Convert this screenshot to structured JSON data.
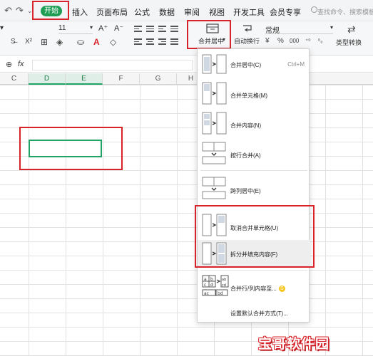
{
  "toolbar": {
    "undo_icon": "undo-icon",
    "redo_icon": "redo-icon",
    "tabs": [
      "开始",
      "插入",
      "页面布局",
      "公式",
      "数据",
      "审阅",
      "视图",
      "开发工具",
      "会员专享"
    ],
    "search_placeholder": "查找命令、搜索模板"
  },
  "ribbon": {
    "font_size": "11",
    "font_grow": "A⁺",
    "font_shrink": "A⁻",
    "merge_label": "合并居中",
    "wrap_label": "自动换行",
    "number_format": "常规",
    "type_convert_label": "类型转换"
  },
  "formula_bar": {
    "fx_label": "fx"
  },
  "sheet": {
    "columns": [
      "C",
      "D",
      "E",
      "F",
      "G",
      "H"
    ],
    "selected_columns": [
      "D",
      "E"
    ]
  },
  "menu": {
    "items": [
      {
        "label": "合并居中(C)",
        "shortcut": "Ctrl+M"
      },
      {
        "label": "合并单元格(M)",
        "shortcut": ""
      },
      {
        "label": "合并内容(N)",
        "shortcut": ""
      },
      {
        "label": "按行合并(A)",
        "shortcut": ""
      },
      {
        "label": "跨列居中(E)",
        "shortcut": ""
      },
      {
        "label": "取消合并单元格(U)",
        "shortcut": ""
      },
      {
        "label": "拆分并填充内容(F)",
        "shortcut": ""
      },
      {
        "label": "合并行/列内容至...",
        "shortcut": ""
      },
      {
        "label": "设置默认合并方式(T)...",
        "shortcut": ""
      }
    ],
    "badge": "S"
  },
  "watermark": "宝哥软件园",
  "colors": {
    "accent_green": "#1f9d55",
    "highlight_red": "#d8232a",
    "selection_green": "#21a366"
  }
}
